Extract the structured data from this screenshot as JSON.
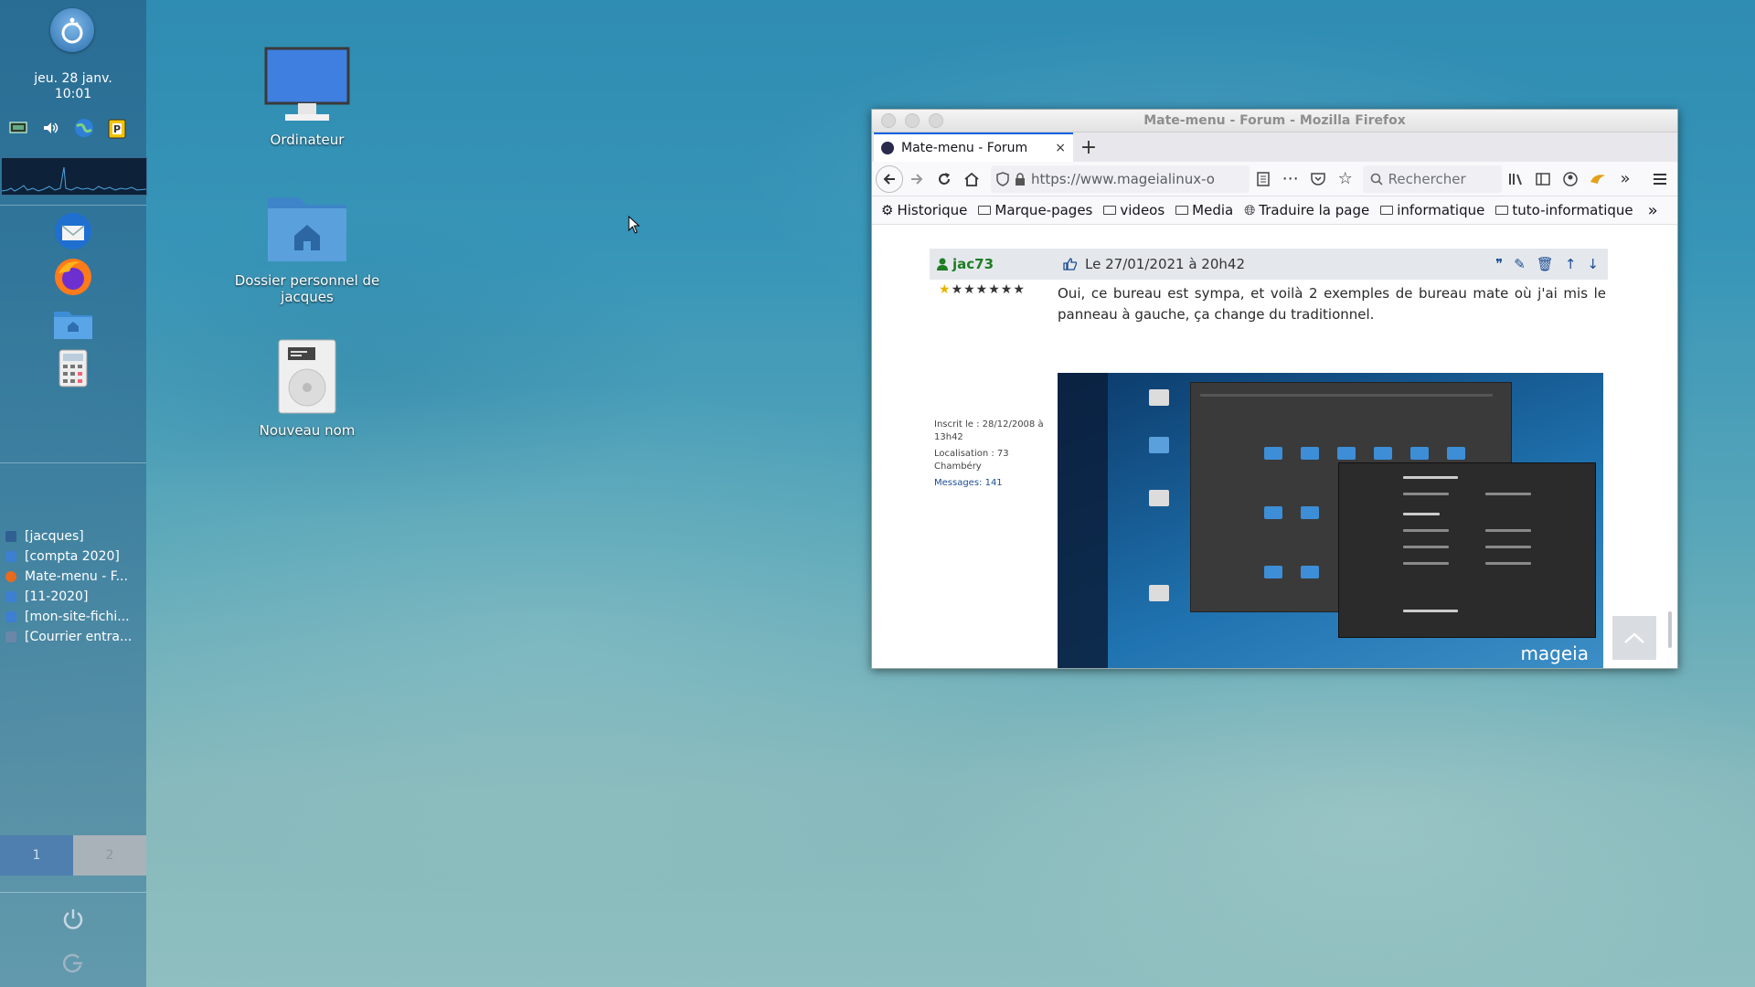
{
  "panel": {
    "clock_date": "jeu. 28 janv.",
    "clock_time": "10:01",
    "tasks": [
      {
        "label": "[jacques]",
        "color": "#3b6aa3"
      },
      {
        "label": "[compta 2020]",
        "color": "#3d7fd0"
      },
      {
        "label": "Mate-menu - F...",
        "color": "#e76a1f"
      },
      {
        "label": "[11-2020]",
        "color": "#3d7fd0"
      },
      {
        "label": "[mon-site-fichi...",
        "color": "#3d7fd0"
      },
      {
        "label": "[Courrier entra...",
        "color": "#6b87a8"
      }
    ],
    "workspaces": [
      "1",
      "2"
    ]
  },
  "desktop": {
    "icons": [
      {
        "label": "Ordinateur",
        "icon": "monitor-icon"
      },
      {
        "label": "Dossier personnel de jacques",
        "icon": "home-folder-icon"
      },
      {
        "label": "Nouveau nom",
        "icon": "drive-icon"
      }
    ]
  },
  "browser": {
    "window_title": "Mate-menu - Forum - Mozilla Firefox",
    "tab_label": "Mate-menu - Forum",
    "tab_close": "×",
    "new_tab": "+",
    "url": "https://www.mageialinux-o",
    "search_placeholder": "Rechercher",
    "bookmarks": [
      "Historique",
      "Marque-pages",
      "videos",
      "Media",
      "Traduire la page",
      "informatique",
      "tuto-informatique"
    ],
    "overflow": "»"
  },
  "post": {
    "username": "jac73",
    "date": "Le 27/01/2021 à 20h42",
    "text": "Oui, ce bureau est sympa, et voilà 2 exemples de bureau mate où j'ai mis le panneau à gauche, ça change du traditionnel.",
    "registered": "Inscrit le : 28/12/2008 à 13h42",
    "location": "Localisation : 73 Chambéry",
    "messages": "Messages: 141",
    "rank_stars": 7,
    "image_brand": "mageia",
    "scroll_top_icon": "chevron-up-icon"
  },
  "colors": {
    "accent": "#0060df",
    "username": "#1f7d24",
    "link": "#1b4c91"
  }
}
